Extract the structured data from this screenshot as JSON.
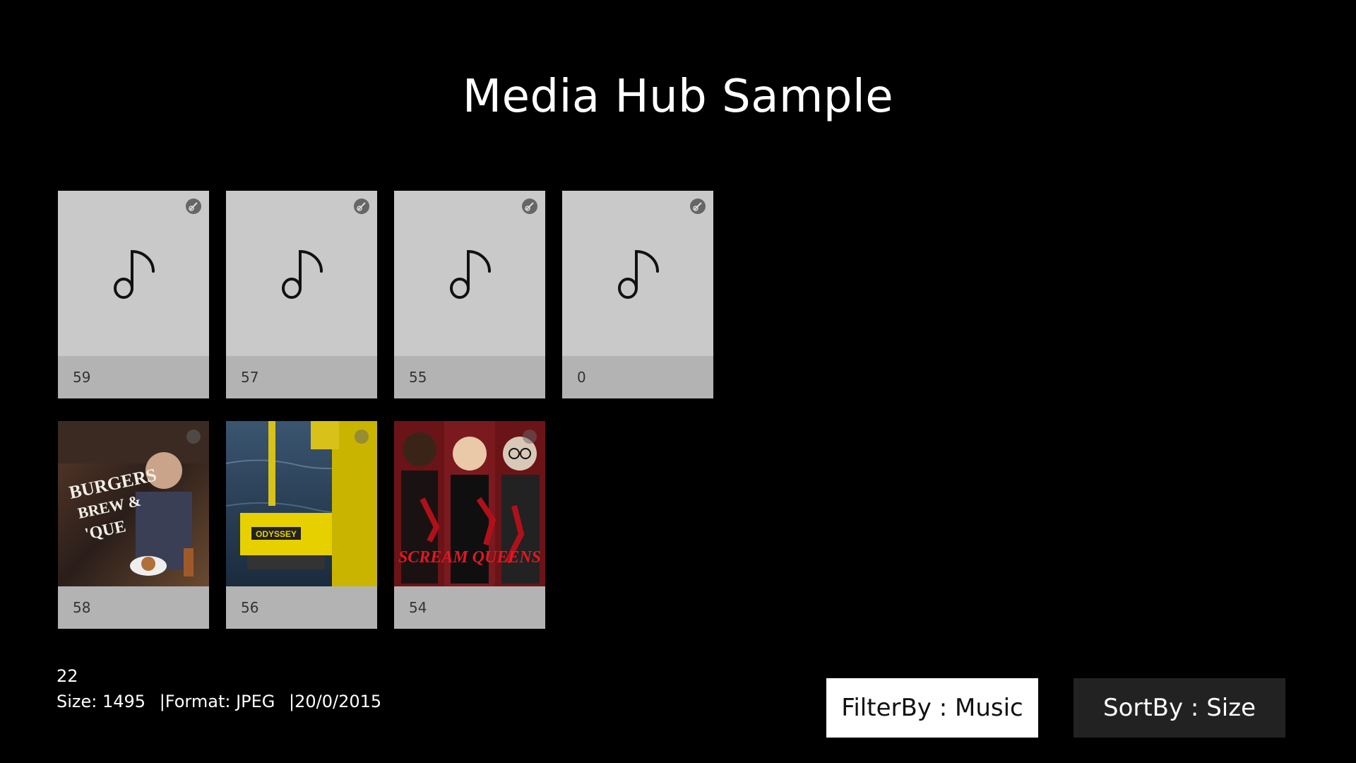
{
  "page": {
    "title": "Media Hub Sample"
  },
  "cards": [
    {
      "label": "59",
      "type": "music"
    },
    {
      "label": "57",
      "type": "music"
    },
    {
      "label": "55",
      "type": "music"
    },
    {
      "label": "0",
      "type": "music"
    },
    {
      "label": "58",
      "type": "image",
      "thumb_text": [
        "BURGERS",
        "BREW &",
        "'QUE"
      ]
    },
    {
      "label": "56",
      "type": "image",
      "thumb_text": [
        "ODYSSEY"
      ]
    },
    {
      "label": "54",
      "type": "image",
      "thumb_text": [
        "SCREAM QUEENS"
      ]
    }
  ],
  "info": {
    "count": "22",
    "size": "Size: 1495",
    "format": "|Format: JPEG",
    "date": "|20/0/2015"
  },
  "controls": {
    "filter_label": "FilterBy : Music",
    "sort_label": "SortBy : Size"
  },
  "colors": {
    "background": "#000000",
    "card_bg": "#c9c9c9",
    "card_label_bg": "#b3b3b3",
    "filter_bg": "#ffffff",
    "sort_bg": "#222222"
  },
  "icons": {
    "music": "music-note-icon",
    "badge": "link-badge-icon"
  }
}
